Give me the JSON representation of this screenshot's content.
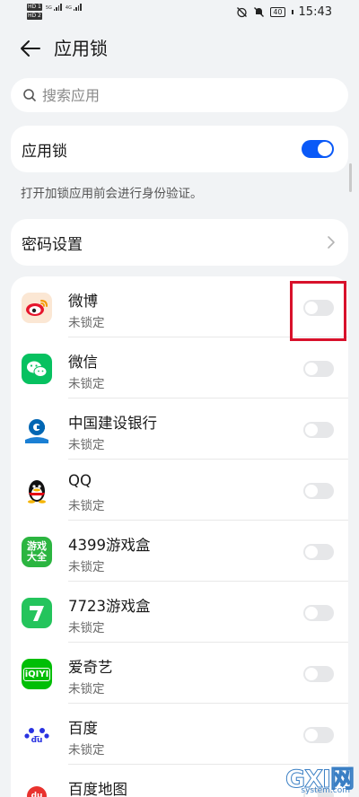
{
  "status_bar": {
    "hd1": "HD 1",
    "hd2": "HD 2",
    "net1": "5G",
    "net2": "4G",
    "battery": "40",
    "time": "15:43"
  },
  "header": {
    "title": "应用锁"
  },
  "search": {
    "placeholder": "搜索应用"
  },
  "app_lock": {
    "label": "应用锁",
    "enabled": true,
    "description": "打开加锁应用前会进行身份验证。"
  },
  "password": {
    "label": "密码设置"
  },
  "apps": [
    {
      "name": "微博",
      "status": "未锁定",
      "icon": "weibo-icon",
      "locked": false
    },
    {
      "name": "微信",
      "status": "未锁定",
      "icon": "wechat-icon",
      "locked": false
    },
    {
      "name": "中国建设银行",
      "status": "未锁定",
      "icon": "ccb-icon",
      "locked": false
    },
    {
      "name": "QQ",
      "status": "未锁定",
      "icon": "qq-icon",
      "locked": false
    },
    {
      "name": "4399游戏盒",
      "status": "未锁定",
      "icon": "4399-icon",
      "icon_text": "游戏大全",
      "locked": false
    },
    {
      "name": "7723游戏盒",
      "status": "未锁定",
      "icon": "7723-icon",
      "locked": false
    },
    {
      "name": "爱奇艺",
      "status": "未锁定",
      "icon": "iqiyi-icon",
      "icon_text": "iQIYI",
      "locked": false
    },
    {
      "name": "百度",
      "status": "未锁定",
      "icon": "baidu-icon",
      "icon_text": "du",
      "locked": false
    },
    {
      "name": "百度地图",
      "status": "",
      "icon": "baidu-map-icon",
      "icon_text": "du",
      "locked": false
    }
  ],
  "watermark": {
    "main": "GXI网",
    "sub": "system.com"
  },
  "colors": {
    "accent": "#0a59f7",
    "highlight": "#d8112b",
    "background": "#f1f3f5"
  }
}
